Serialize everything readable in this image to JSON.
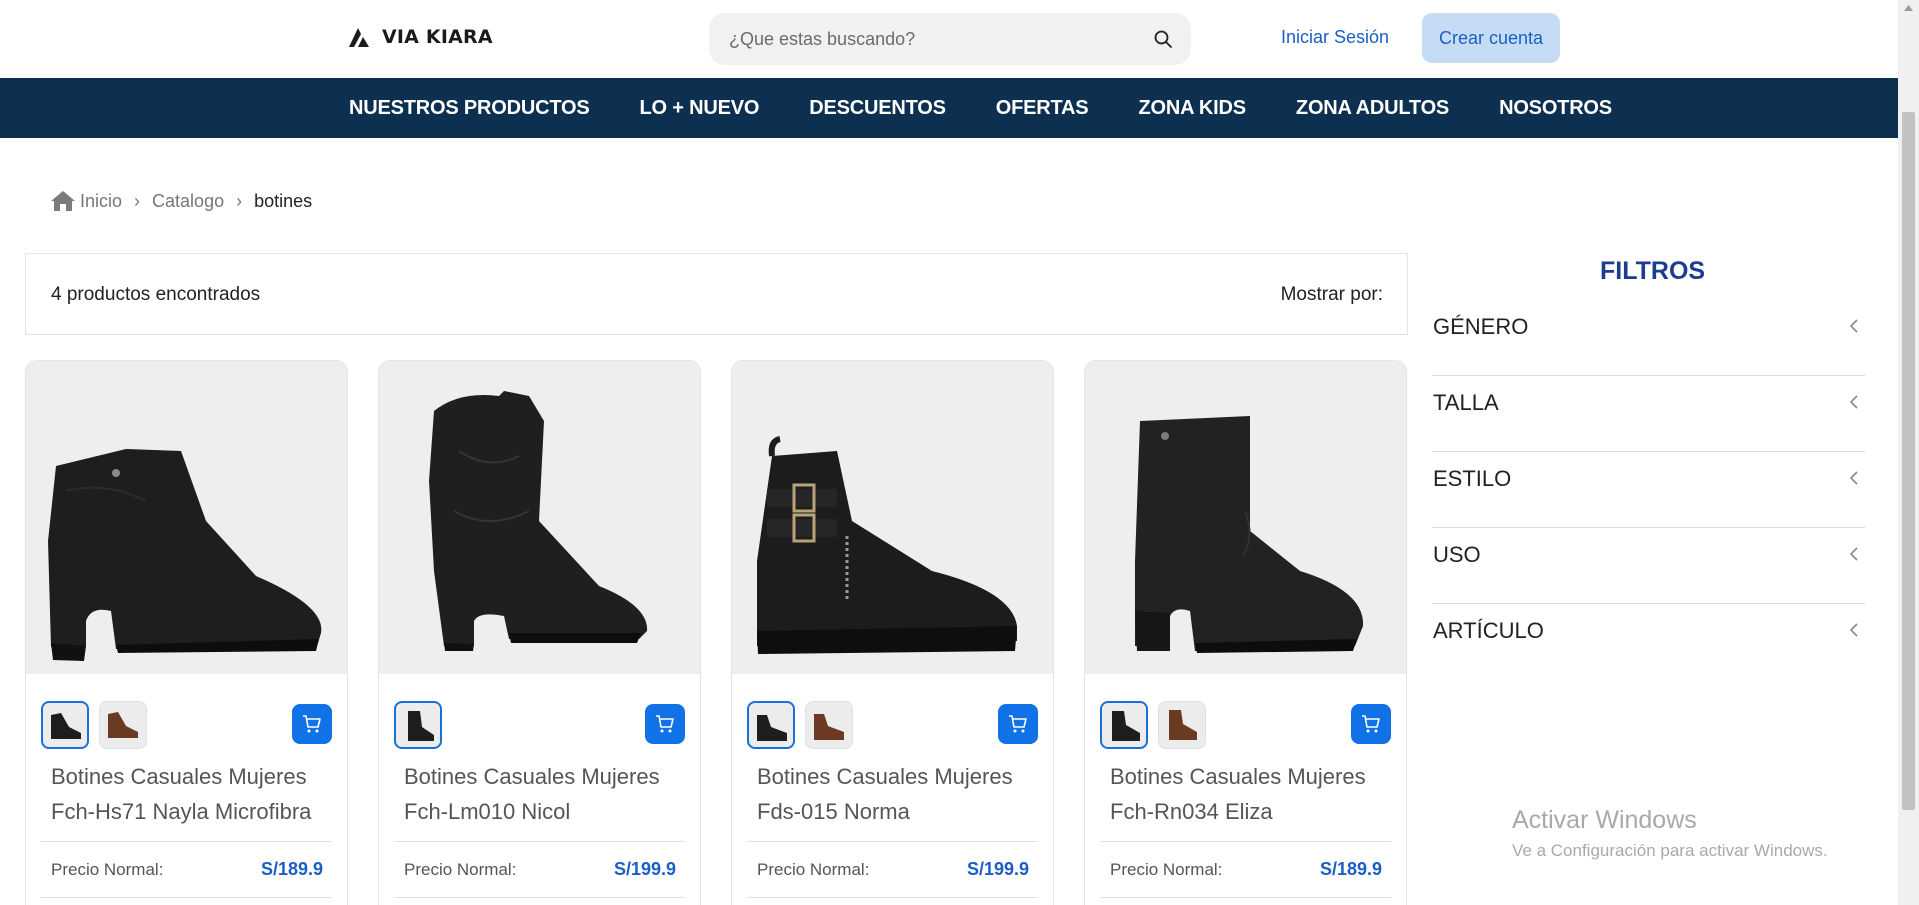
{
  "header": {
    "logo_text": "VIA KIARA",
    "search_placeholder": "¿Que estas buscando?",
    "login_label": "Iniciar Sesión",
    "create_account_label": "Crear cuenta"
  },
  "nav": {
    "items": [
      "NUESTROS PRODUCTOS",
      "LO + NUEVO",
      "DESCUENTOS",
      "OFERTAS",
      "ZONA KIDS",
      "ZONA ADULTOS",
      "NOSOTROS"
    ]
  },
  "breadcrumb": {
    "home": "Inicio",
    "catalog": "Catalogo",
    "current": "botines"
  },
  "results": {
    "count_text": "4 productos encontrados",
    "show_by_label": "Mostrar por:"
  },
  "products": [
    {
      "name": "Botines Casuales Mujeres Fch-Hs71 Nayla Microfibra",
      "price_label": "Precio Normal:",
      "price": "S/189.9",
      "swatches": [
        "black",
        "brown"
      ]
    },
    {
      "name": "Botines Casuales Mujeres Fch-Lm010 Nicol",
      "price_label": "Precio Normal:",
      "price": "S/199.9",
      "swatches": [
        "black"
      ]
    },
    {
      "name": "Botines Casuales Mujeres Fds-015 Norma",
      "price_label": "Precio Normal:",
      "price": "S/199.9",
      "swatches": [
        "black",
        "brown"
      ]
    },
    {
      "name": "Botines Casuales Mujeres Fch-Rn034 Eliza",
      "price_label": "Precio Normal:",
      "price": "S/189.9",
      "swatches": [
        "black",
        "brown"
      ]
    }
  ],
  "filters": {
    "title": "FILTROS",
    "items": [
      "GÉNERO",
      "TALLA",
      "ESTILO",
      "USO",
      "ARTÍCULO"
    ]
  },
  "watermark": {
    "line1": "Activar Windows",
    "line2": "Ve a Configuración para activar Windows."
  },
  "colors": {
    "nav_bg": "#0d3050",
    "accent_blue": "#1172e8",
    "link_blue": "#1a5fc7",
    "create_btn_bg": "#c6dcf5",
    "filters_title": "#1c3d8f"
  }
}
